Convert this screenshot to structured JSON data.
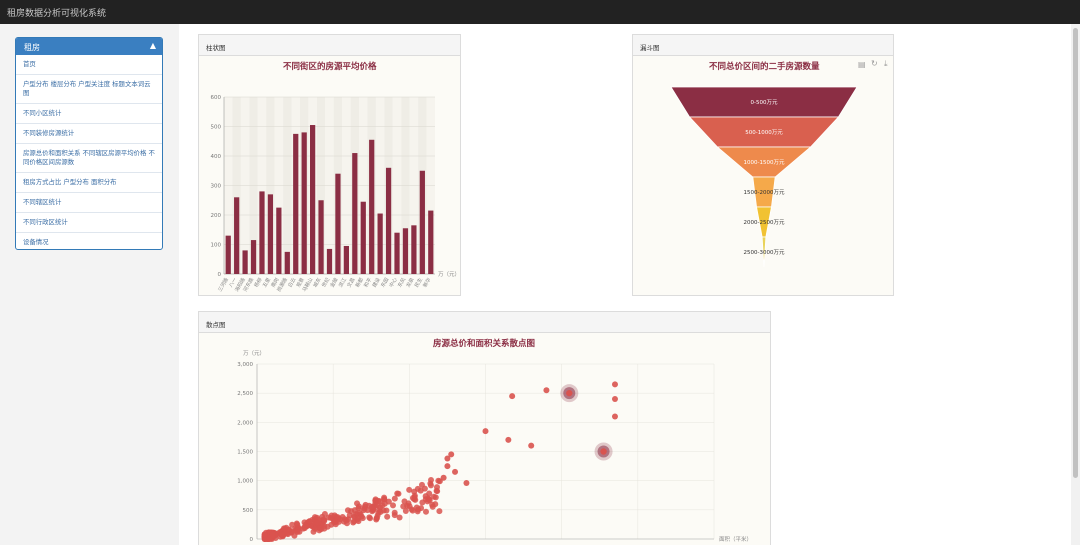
{
  "app": {
    "title": "租房数据分析可视化系统"
  },
  "sidebar": {
    "header": "租房",
    "items": [
      "首页",
      "户型分布 楼层分布 户型关注度 标题文本词云图",
      "不同小区统计",
      "不同装修房源统计",
      "房源总价和面积关系 不同辖区房源平均价格 不同价格区间房源数",
      "租房方式占比 户型分布 面积分布",
      "不同辖区统计",
      "不同行政区统计",
      "设备情况"
    ]
  },
  "panels": {
    "bar": {
      "heading": "柱状图",
      "title": "不同街区的房源平均价格"
    },
    "funnel": {
      "heading": "漏斗图",
      "title": "不同总价区间的二手房源数量"
    },
    "scatter": {
      "heading": "散点图",
      "title": "房源总价和面积关系散点图"
    }
  },
  "icons": {
    "tool1": "data-view-icon",
    "tool2": "refresh-icon",
    "tool3": "download-icon",
    "collapse": "chevron-up-icon"
  },
  "colors": {
    "bar": "#8b2e44",
    "scatter": "#d9534f",
    "header": "#222222",
    "menu": "#3a7fc1"
  },
  "chart_data": [
    {
      "type": "bar",
      "title": "不同街区的房源平均价格",
      "unit": "万（元）",
      "ylim": [
        0,
        600
      ],
      "yticks": [
        0,
        100,
        200,
        300,
        400,
        500,
        600
      ],
      "categories": [
        "三河路",
        "八一",
        "海阳路",
        "河东路",
        "杨柳",
        "五里",
        "南岗",
        "岗源路",
        "白云",
        "观景",
        "马鞍山",
        "城东",
        "世纪",
        "金陵",
        "滨江",
        "文昌",
        "新都",
        "和平",
        "建设",
        "东园",
        "中心",
        "东风",
        "龙泉",
        "民生",
        "新华",
        "城北",
        "园林",
        "西城"
      ],
      "values": [
        130,
        260,
        80,
        115,
        280,
        270,
        225,
        75,
        475,
        480,
        505,
        250,
        85,
        340,
        95,
        410,
        245,
        455,
        205,
        360,
        140,
        155,
        165,
        350,
        215
      ]
    },
    {
      "type": "funnel",
      "title": "不同总价区间的二手房源数量",
      "categories": [
        "0-500万元",
        "500-1000万元",
        "1000-1500万元",
        "1500-2000万元",
        "2000-2500万元",
        "2500-3000万元"
      ],
      "values": [
        100,
        80,
        50,
        12,
        8,
        2
      ],
      "colors": [
        "#8b2e44",
        "#d9604f",
        "#ee8a4c",
        "#f5a94a",
        "#f1c232",
        "#e9d35a"
      ]
    },
    {
      "type": "scatter",
      "title": "房源总价和面积关系散点图",
      "ylabel": "万（元）",
      "xlabel": "面积（平米）",
      "ylim": [
        0,
        3000
      ],
      "yticks": [
        "0",
        "500",
        "1,000",
        "1,500",
        "2,000",
        "2,500",
        "3,000"
      ],
      "xlim": [
        0,
        600
      ],
      "highlights": [
        [
          410,
          2500
        ],
        [
          455,
          1500
        ]
      ]
    }
  ]
}
